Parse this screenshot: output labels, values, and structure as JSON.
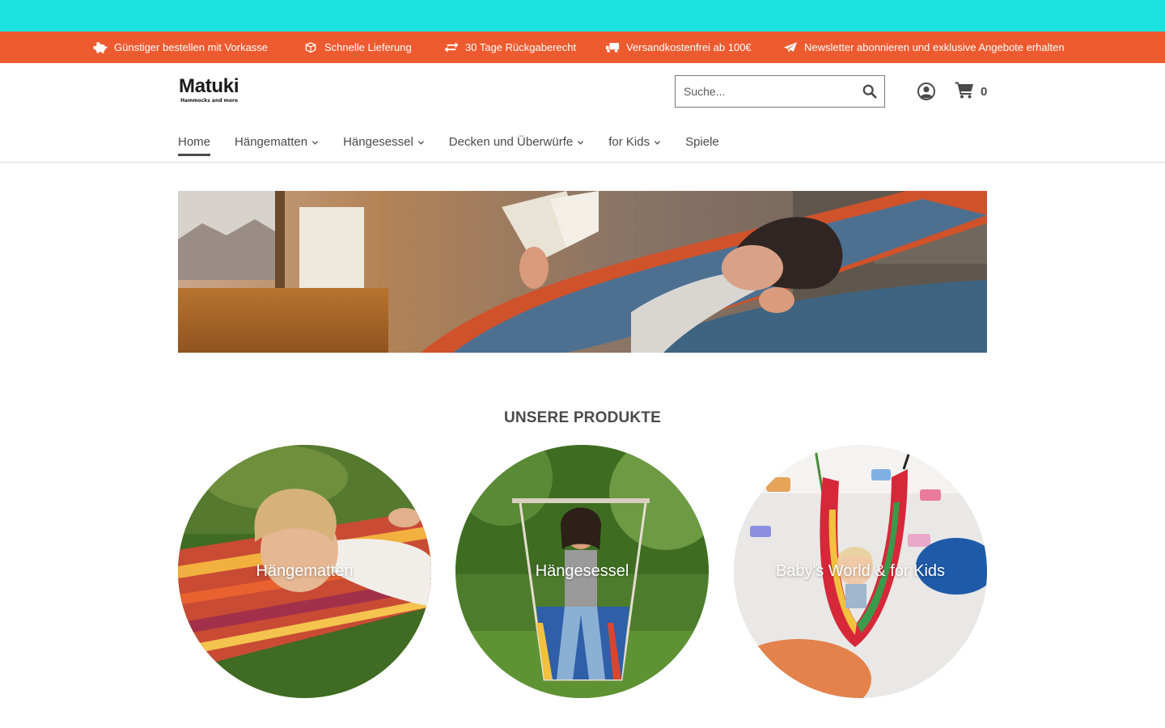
{
  "colors": {
    "top_bar": "#1de3e0",
    "benefit_bar": "#ee5a2f",
    "text": "#4a4a4a"
  },
  "benefits": [
    {
      "icon": "piggy-bank-icon",
      "label": "Günstiger bestellen mit Vorkasse"
    },
    {
      "icon": "package-icon",
      "label": "Schnelle Lieferung"
    },
    {
      "icon": "exchange-arrows-icon",
      "label": "30 Tage Rückgaberecht"
    },
    {
      "icon": "truck-icon",
      "label": "Versandkostenfrei ab 100€"
    },
    {
      "icon": "paper-plane-icon",
      "label": "Newsletter abonnieren und exklusive Angebote erhalten"
    }
  ],
  "logo": {
    "name": "Matuki",
    "tagline": "Hammocks and more"
  },
  "search": {
    "placeholder": "Suche...",
    "icon": "search-icon"
  },
  "account": {
    "icon": "user-circle-icon"
  },
  "cart": {
    "icon": "shopping-cart-icon",
    "count": "0"
  },
  "nav": [
    {
      "label": "Home",
      "active": true,
      "has_dropdown": false
    },
    {
      "label": "Hängematten",
      "active": false,
      "has_dropdown": true
    },
    {
      "label": "Hängesessel",
      "active": false,
      "has_dropdown": true
    },
    {
      "label": "Decken und Überwürfe",
      "active": false,
      "has_dropdown": true
    },
    {
      "label": "for Kids",
      "active": false,
      "has_dropdown": true
    },
    {
      "label": "Spiele",
      "active": false,
      "has_dropdown": false
    }
  ],
  "products": {
    "title": "UNSERE PRODUKTE",
    "categories": [
      {
        "label": "Hängematten"
      },
      {
        "label": "Hängesessel"
      },
      {
        "label": "Baby's World & for Kids"
      }
    ]
  }
}
